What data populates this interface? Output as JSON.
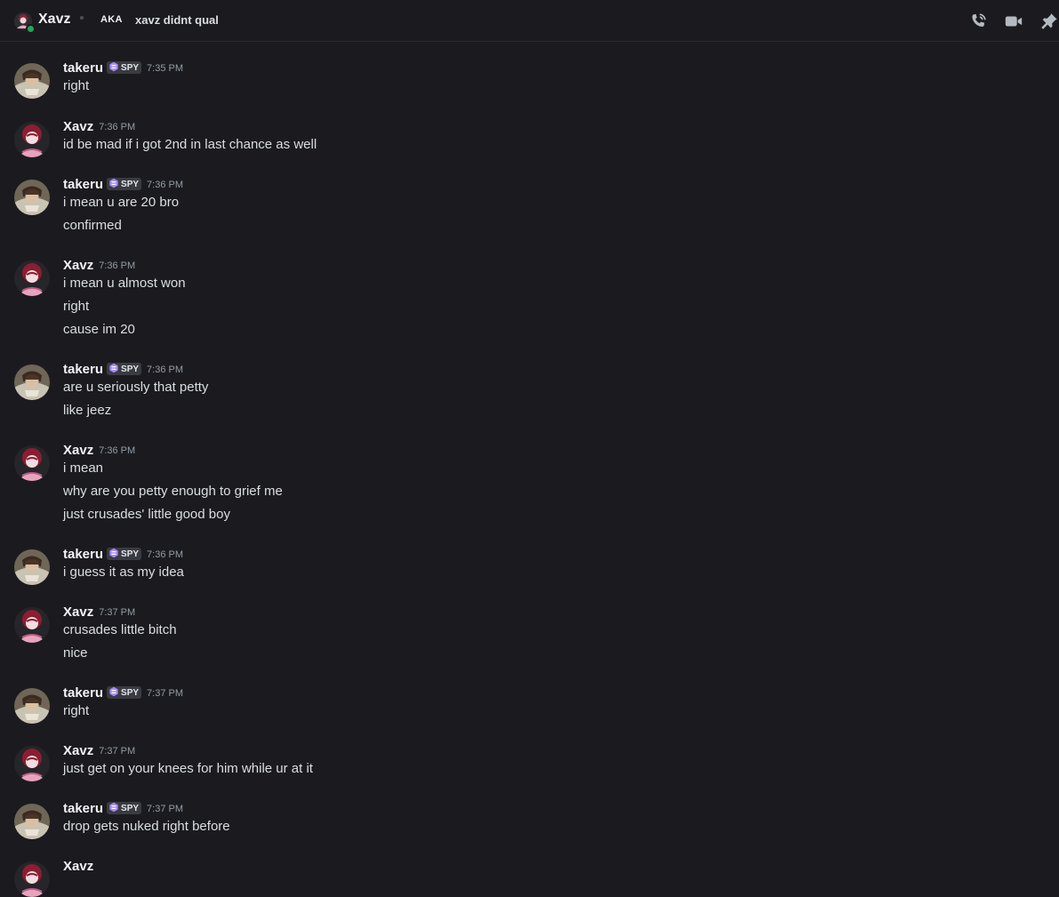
{
  "header": {
    "name": "Xavz",
    "aka_label": "AKA",
    "aka_value": "xavz didnt qual",
    "status_color": "#23a55a",
    "icons": [
      "phone-call-icon",
      "video-camera-icon",
      "pin-icon"
    ]
  },
  "tag": {
    "label": "SPY",
    "color": "#a78bfa"
  },
  "messages": [
    {
      "author": "takeru",
      "time": "7:35 PM",
      "lines": [
        "right"
      ]
    },
    {
      "author": "Xavz",
      "time": "7:36 PM",
      "lines": [
        "id be mad if i got 2nd in last chance as well"
      ]
    },
    {
      "author": "takeru",
      "time": "7:36 PM",
      "lines": [
        "i mean u are 20 bro",
        "confirmed"
      ]
    },
    {
      "author": "Xavz",
      "time": "7:36 PM",
      "lines": [
        "i mean u almost won",
        "right",
        "cause im 20"
      ]
    },
    {
      "author": "takeru",
      "time": "7:36 PM",
      "lines": [
        "are u seriously that petty",
        "like jeez"
      ]
    },
    {
      "author": "Xavz",
      "time": "7:36 PM",
      "lines": [
        "i mean",
        "why are you petty enough to grief me",
        "just crusades' little good boy"
      ]
    },
    {
      "author": "takeru",
      "time": "7:36 PM",
      "lines": [
        "i guess it as my idea"
      ]
    },
    {
      "author": "Xavz",
      "time": "7:37 PM",
      "lines": [
        "crusades little bitch",
        "nice"
      ]
    },
    {
      "author": "takeru",
      "time": "7:37 PM",
      "lines": [
        "right"
      ]
    },
    {
      "author": "Xavz",
      "time": "7:37 PM",
      "lines": [
        "just get on your knees for him while ur at it"
      ]
    },
    {
      "author": "takeru",
      "time": "7:37 PM",
      "lines": [
        "drop gets nuked right before"
      ]
    },
    {
      "author": "Xavz",
      "time": "",
      "lines": []
    }
  ]
}
